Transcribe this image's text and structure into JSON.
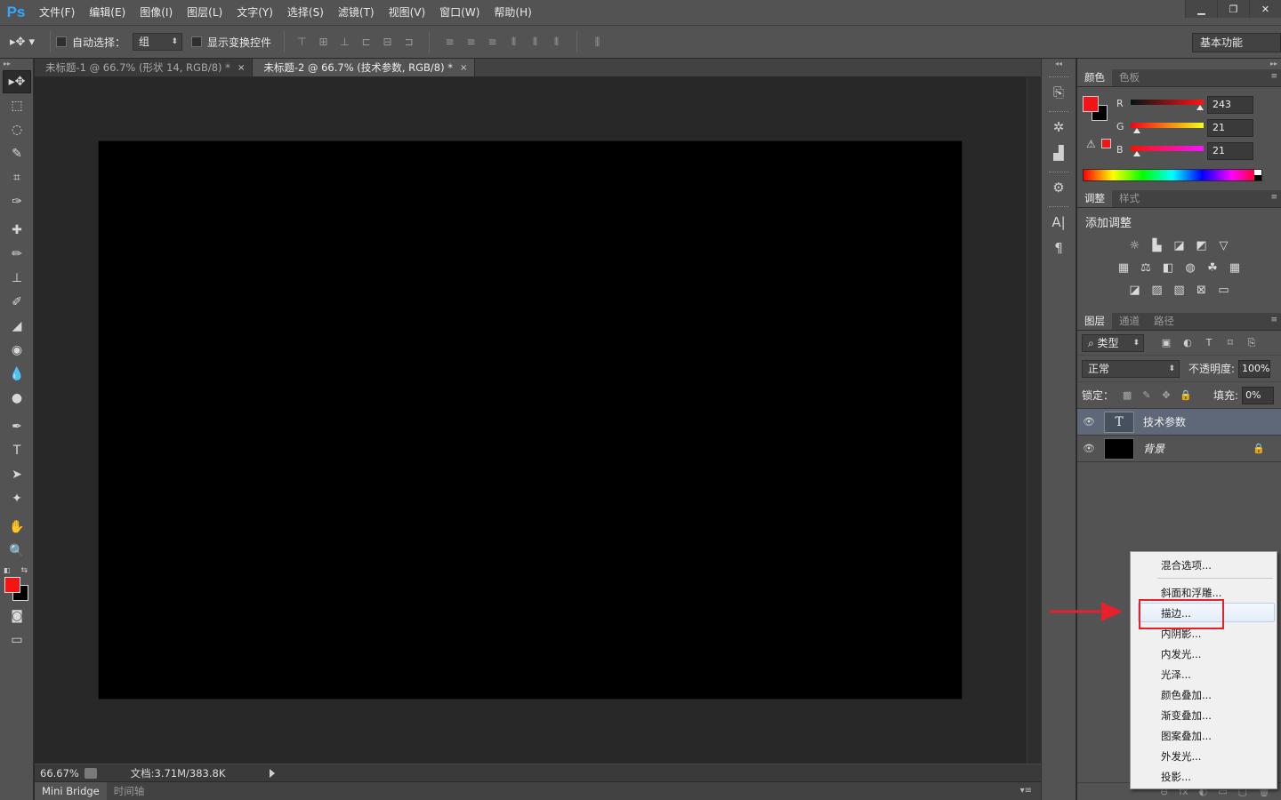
{
  "menubar": {
    "logo": "Ps",
    "items": [
      "文件(F)",
      "编辑(E)",
      "图像(I)",
      "图层(L)",
      "文字(Y)",
      "选择(S)",
      "滤镜(T)",
      "视图(V)",
      "窗口(W)",
      "帮助(H)"
    ],
    "window_controls": [
      "▁",
      "❐",
      "✕"
    ]
  },
  "options": {
    "auto_select_label": "自动选择：",
    "auto_select_value": "组",
    "show_transform_label": "显示变换控件",
    "workspace": "基本功能"
  },
  "tabs": [
    {
      "label": "未标题-1 @ 66.7% (形状 14, RGB/8) *",
      "close": "×",
      "active": false
    },
    {
      "label": "未标题-2 @ 66.7% (技术参数, RGB/8) *",
      "close": "×",
      "active": true
    }
  ],
  "status": {
    "zoom": "66.67%",
    "doc_info": "文档:3.71M/383.8K"
  },
  "bottom_tabs": [
    "Mini Bridge",
    "时间轴"
  ],
  "color_panel": {
    "tabs": [
      "颜色",
      "色板"
    ],
    "fg_color": "#f31515",
    "bg_color": "#000000",
    "warning_icon": "⚠",
    "channels": [
      {
        "label": "R",
        "value": "243",
        "fraction": 0.953
      },
      {
        "label": "G",
        "value": "21",
        "fraction": 0.082
      },
      {
        "label": "B",
        "value": "21",
        "fraction": 0.082
      }
    ]
  },
  "adjustments_panel": {
    "tabs": [
      "调整",
      "样式"
    ],
    "title": "添加调整"
  },
  "layers_panel": {
    "tabs": [
      "图层",
      "通道",
      "路径"
    ],
    "filter_label": "⌕ 类型",
    "blend_mode": "正常",
    "opacity_label": "不透明度:",
    "opacity_value": "100%",
    "lock_label": "锁定：",
    "fill_label": "填充:",
    "fill_value": "0%",
    "layers": [
      {
        "name": "技术参数",
        "type": "text",
        "thumb_glyph": "T",
        "selected": true
      },
      {
        "name": "背景",
        "type": "background",
        "selected": false
      }
    ],
    "footer_icons": [
      "⊖",
      "fx",
      "◐",
      "▭",
      "▢",
      "🗑"
    ]
  },
  "context_menu": {
    "items": [
      "混合选项...",
      "斜面和浮雕...",
      "描边...",
      "内阴影...",
      "内发光...",
      "光泽...",
      "颜色叠加...",
      "渐变叠加...",
      "图案叠加...",
      "外发光...",
      "投影..."
    ],
    "highlighted": "描边..."
  },
  "annotation_color": "#e5212b"
}
